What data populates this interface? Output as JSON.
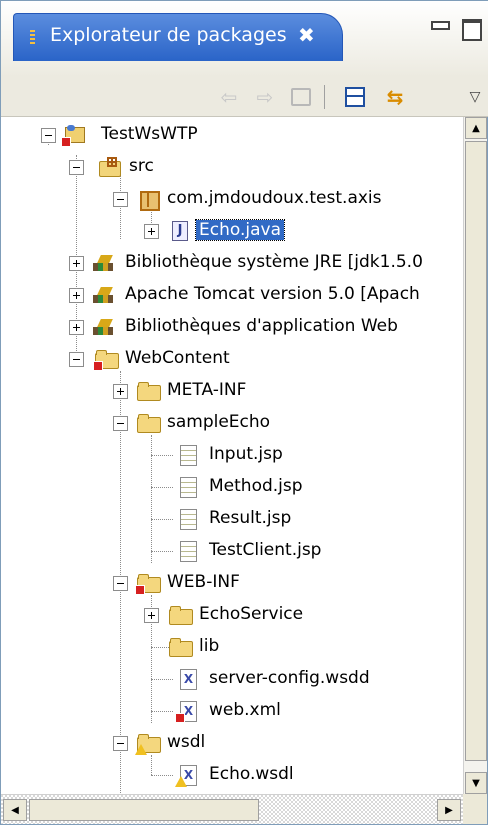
{
  "view": {
    "title": "Explorateur de packages",
    "close_glyph": "✖"
  },
  "toolbar": {
    "back_glyph": "⇦",
    "forward_glyph": "⇨",
    "link_glyph": "⇆",
    "menu_glyph": "▽"
  },
  "tree": {
    "project": "TestWsWTP",
    "src": "src",
    "package": "com.jmdoudoux.test.axis",
    "java_file": "Echo.java",
    "jre_lib": "Bibliothèque système JRE [jdk1.5.0",
    "tomcat_lib": "Apache Tomcat version 5.0 [Apach",
    "web_lib": "Bibliothèques d'application Web",
    "web_content": "WebContent",
    "meta_inf": "META-INF",
    "sample_echo": "sampleEcho",
    "input_jsp": "Input.jsp",
    "method_jsp": "Method.jsp",
    "result_jsp": "Result.jsp",
    "testclient_jsp": "TestClient.jsp",
    "web_inf": "WEB-INF",
    "echo_service": "EchoService",
    "lib": "lib",
    "server_config": "server-config.wsdd",
    "web_xml": "web.xml",
    "wsdl": "wsdl",
    "echo_wsdl": "Echo.wsdl"
  },
  "scrollbars": {
    "up": "▲",
    "down": "▼",
    "left": "◀",
    "right": "▶"
  }
}
